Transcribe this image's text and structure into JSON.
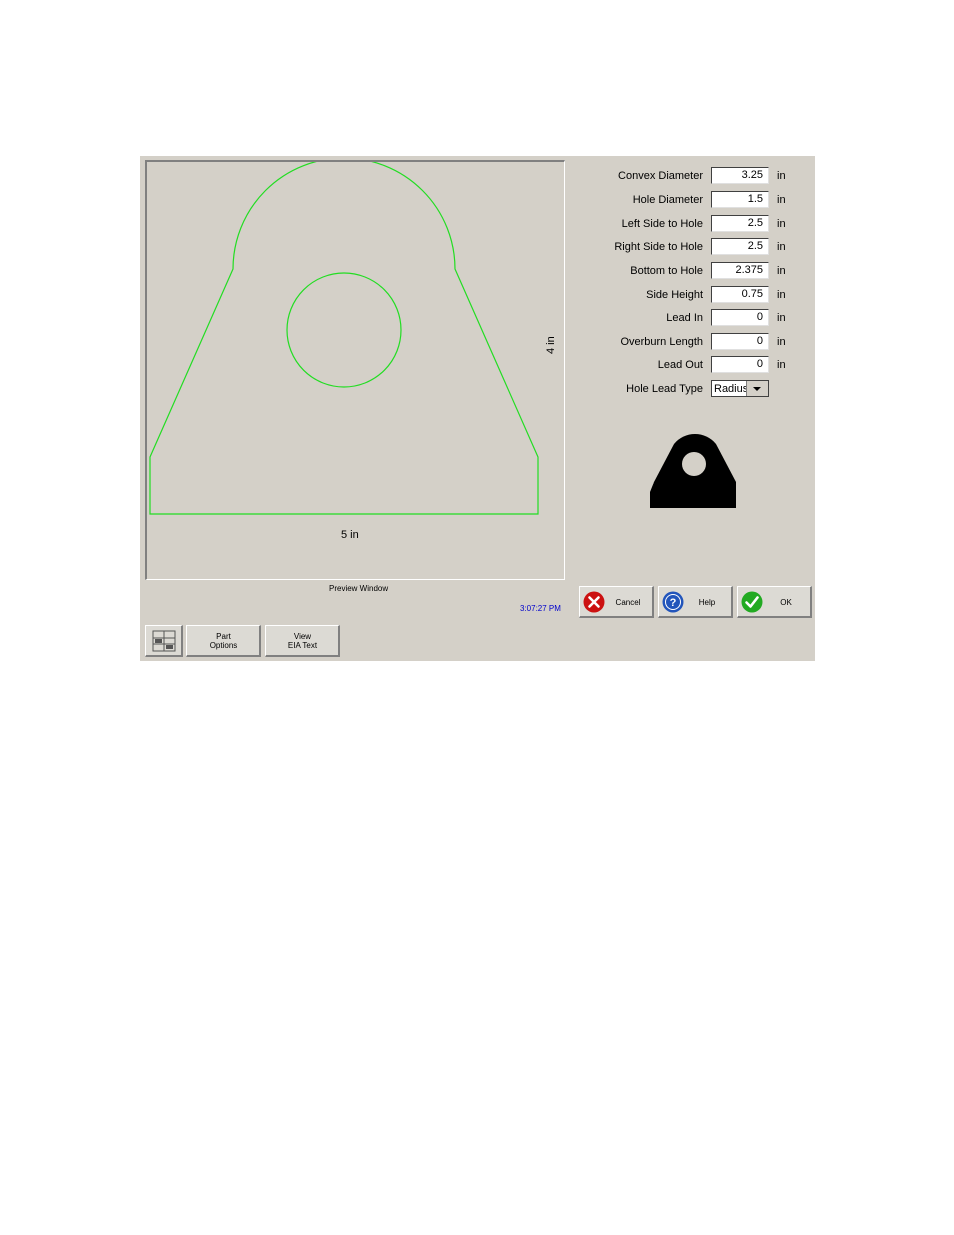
{
  "preview": {
    "caption": "Preview Window",
    "width_label": "5 in",
    "height_label": "4 in",
    "outline_color": "#22dd22"
  },
  "clock": "3:07:27 PM",
  "fields": [
    {
      "label": "Convex Diameter",
      "value": "3.25",
      "unit": "in"
    },
    {
      "label": "Hole Diameter",
      "value": "1.5",
      "unit": "in"
    },
    {
      "label": "Left Side to Hole",
      "value": "2.5",
      "unit": "in"
    },
    {
      "label": "Right Side to Hole",
      "value": "2.5",
      "unit": "in"
    },
    {
      "label": "Bottom to Hole",
      "value": "2.375",
      "unit": "in"
    },
    {
      "label": "Side Height",
      "value": "0.75",
      "unit": "in"
    },
    {
      "label": "Lead In",
      "value": "0",
      "unit": "in"
    },
    {
      "label": "Overburn Length",
      "value": "0",
      "unit": "in"
    },
    {
      "label": "Lead Out",
      "value": "0",
      "unit": "in"
    }
  ],
  "hole_lead_type": {
    "label": "Hole Lead Type",
    "value": "Radius"
  },
  "buttons": {
    "cancel": "Cancel",
    "help": "Help",
    "ok": "OK",
    "part_options_line1": "Part",
    "part_options_line2": "Options",
    "view_eia_line1": "View",
    "view_eia_line2": "EIA Text"
  },
  "icons": {
    "cancel": "x-circle-icon",
    "help": "question-circle-icon",
    "ok": "check-circle-icon",
    "units": "units-grid-icon"
  },
  "colors": {
    "panel": "#d4d0c8",
    "cancel_icon": "#cc1111",
    "help_icon": "#2255bb",
    "ok_icon": "#22aa22",
    "clock_text": "#0000cc"
  }
}
